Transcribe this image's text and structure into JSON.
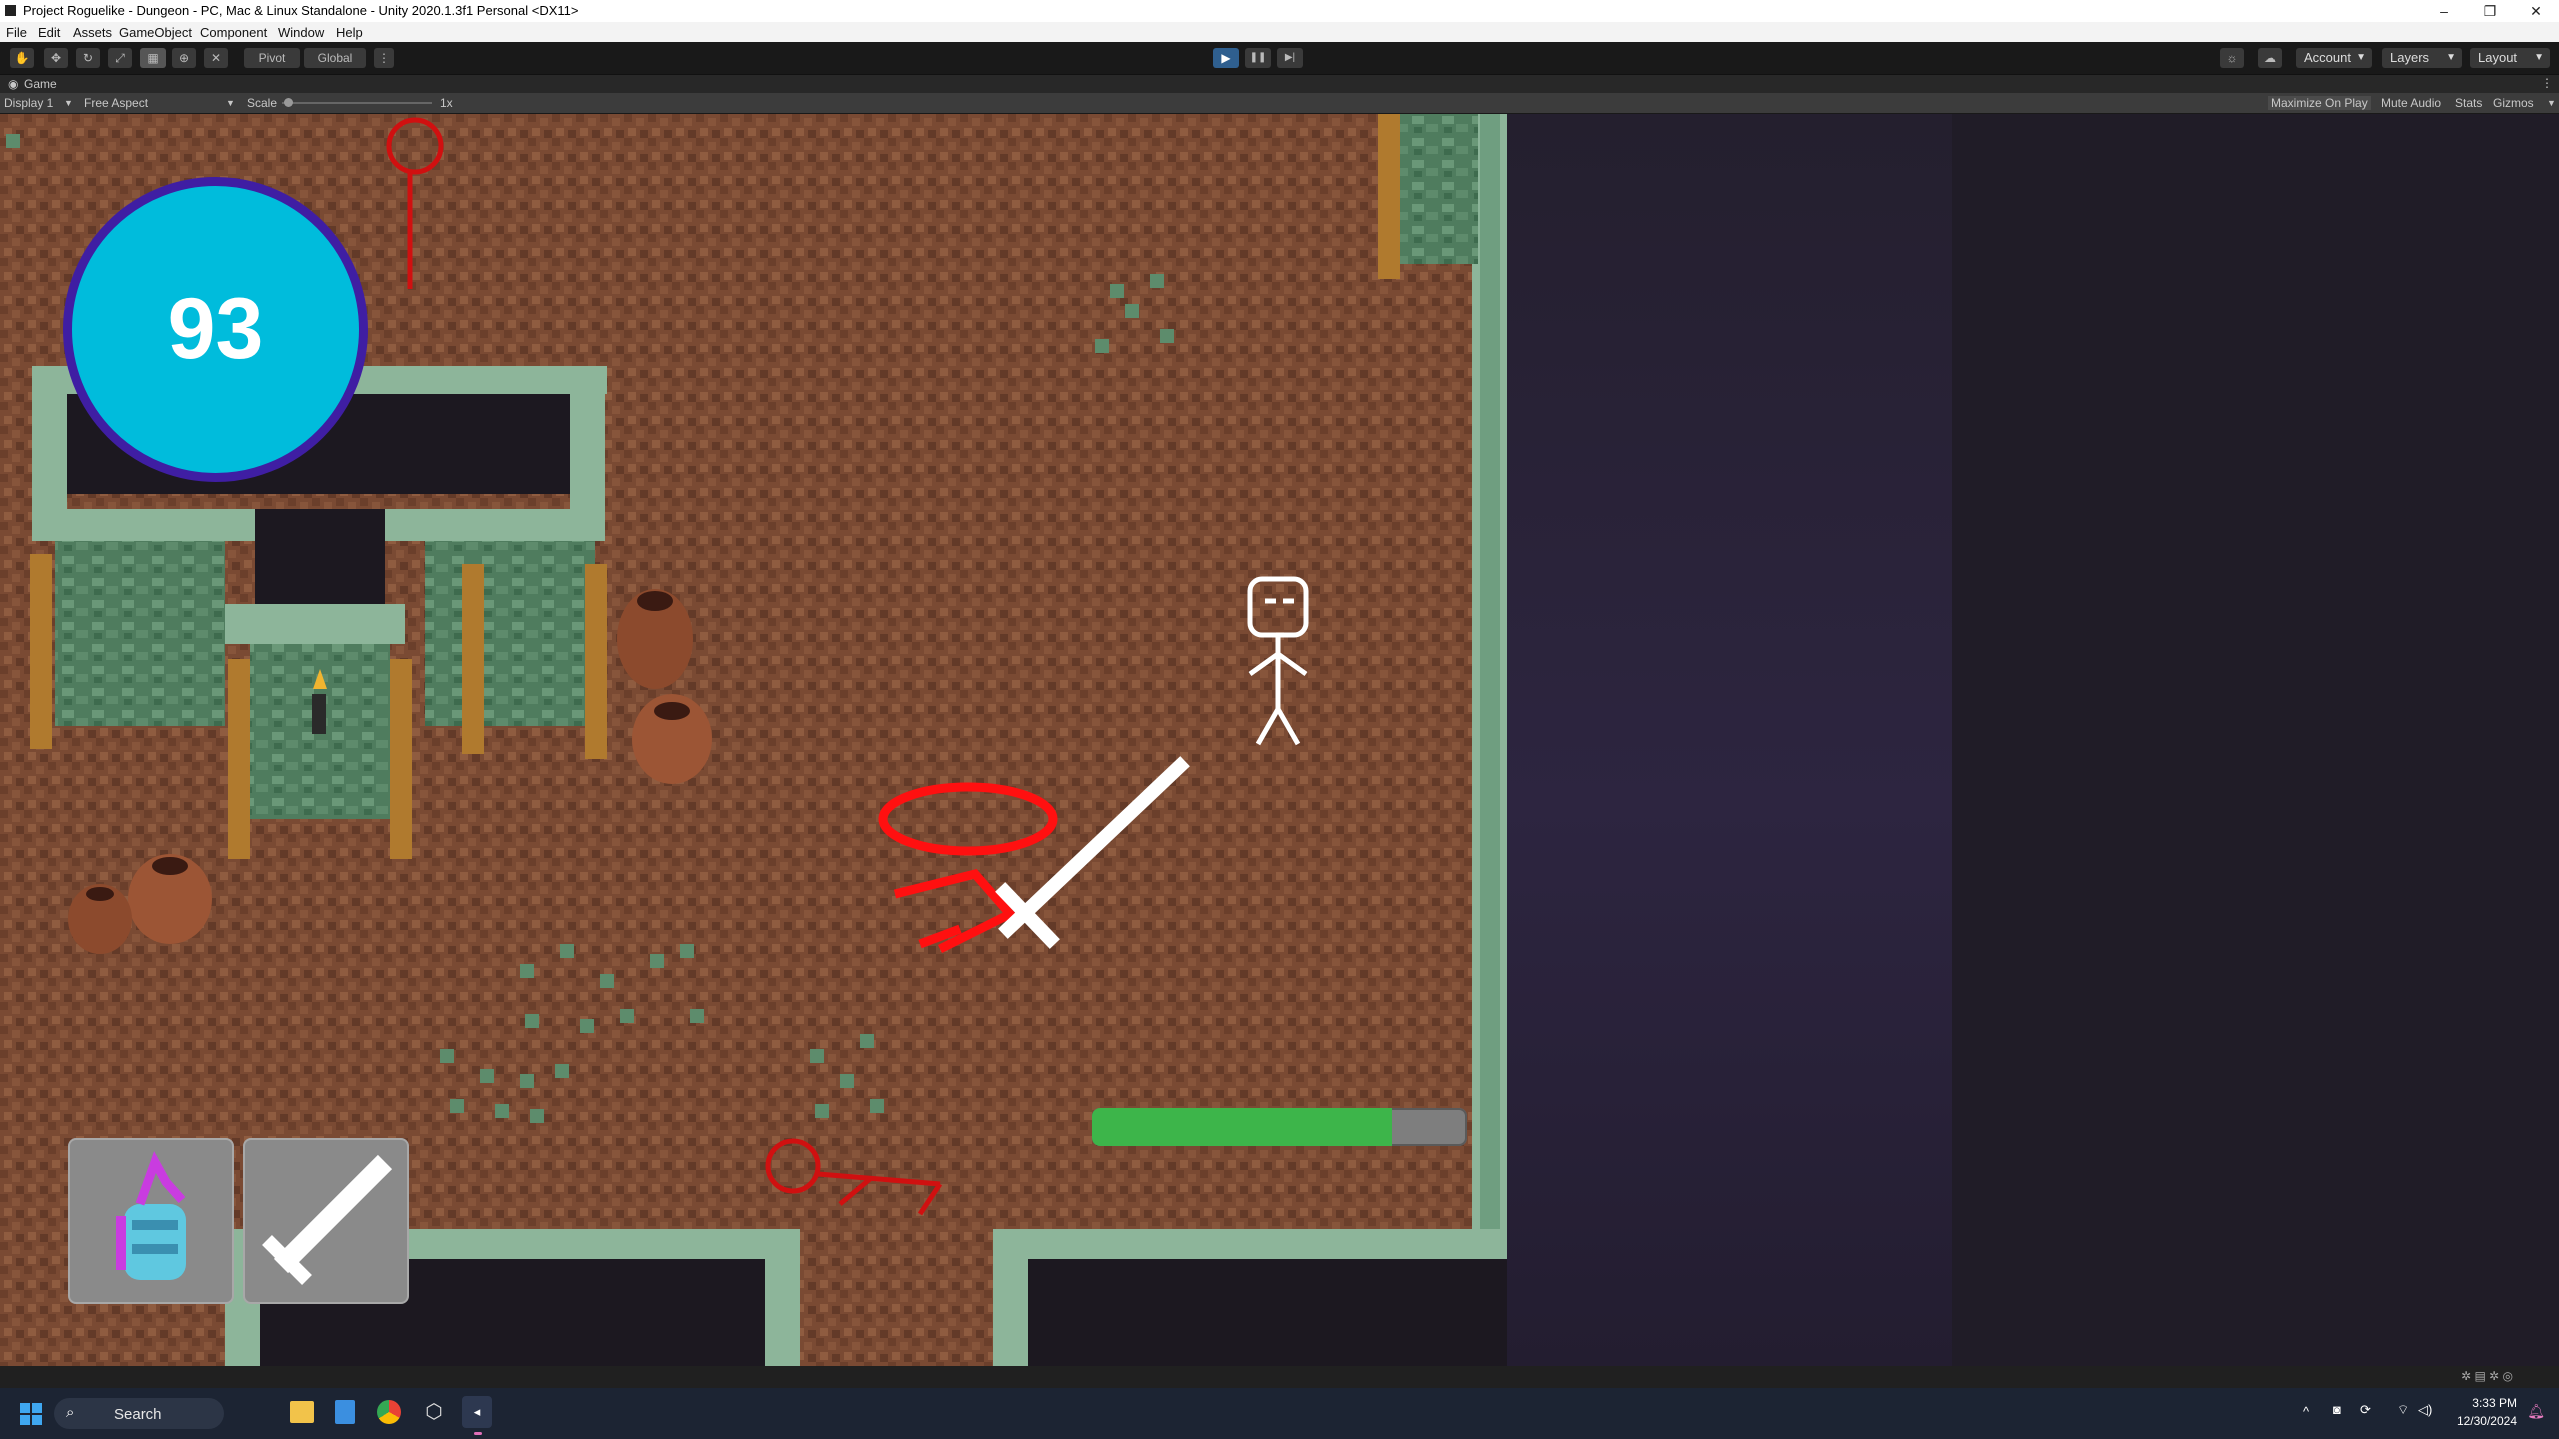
{
  "window": {
    "title": "Project Roguelike - Dungeon - PC, Mac & Linux Standalone - Unity 2020.1.3f1 Personal <DX11>",
    "minimize": "–",
    "maximize": "❐",
    "close": "✕"
  },
  "menu": [
    "File",
    "Edit",
    "Assets",
    "GameObject",
    "Component",
    "Window",
    "Help"
  ],
  "toolbar": {
    "pivot": "Pivot",
    "global": "Global",
    "play_icon": "▶",
    "pause_icon": "❚❚",
    "step_icon": "▶|",
    "account": "Account",
    "layers": "Layers",
    "layout": "Layout"
  },
  "game_tab": {
    "label": "Game"
  },
  "game_bar": {
    "display": "Display 1",
    "aspect": "Free Aspect",
    "scale_label": "Scale",
    "scale_value": "1x",
    "maximize_on_play": "Maximize On Play",
    "mute_audio": "Mute Audio",
    "stats": "Stats",
    "gizmos": "Gizmos"
  },
  "hud": {
    "coin_count": "93",
    "health_fraction": 0.8,
    "health_color": "#3db54a",
    "coin_color": "#00bcdc",
    "slots": [
      {
        "item": "potion-icon"
      },
      {
        "item": "sword-icon"
      }
    ]
  },
  "taskbar": {
    "search_placeholder": "Search",
    "time": "3:33 PM",
    "date": "12/30/2024"
  }
}
